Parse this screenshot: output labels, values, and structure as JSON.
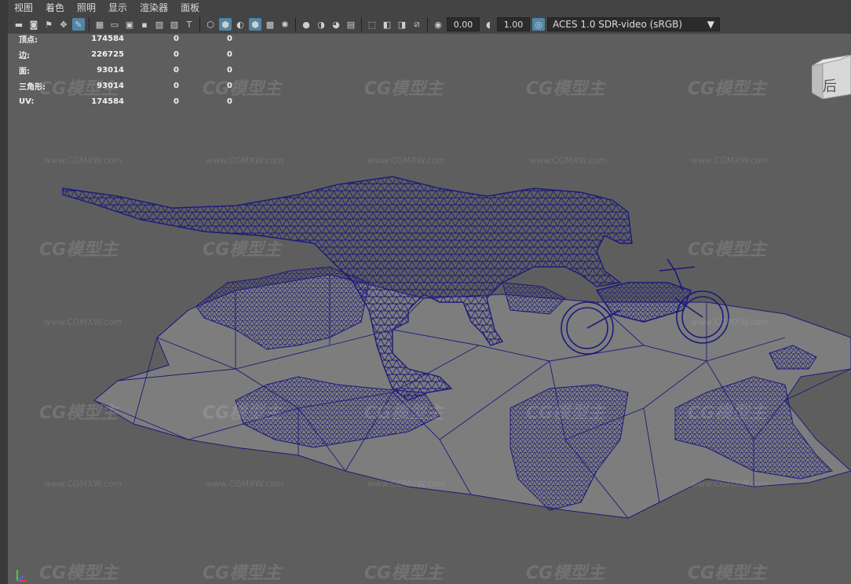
{
  "menu": [
    "视图",
    "着色",
    "照明",
    "显示",
    "渲染器",
    "面板"
  ],
  "toolbar": {
    "near_clip": "0.00",
    "gamma": "1.00",
    "colorspace": "ACES 1.0 SDR-video (sRGB)"
  },
  "hud": {
    "rows": [
      {
        "label": "顶点:",
        "a": "174584",
        "b": "0",
        "c": "0"
      },
      {
        "label": "边:",
        "a": "226725",
        "b": "0",
        "c": "0"
      },
      {
        "label": "面:",
        "a": "93014",
        "b": "0",
        "c": "0"
      },
      {
        "label": "三角形:",
        "a": "93014",
        "b": "0",
        "c": "0"
      },
      {
        "label": "UV:",
        "a": "174584",
        "b": "0",
        "c": "0"
      }
    ]
  },
  "viewcube": {
    "face_label": "后"
  },
  "watermark": {
    "logo": "CG模型主",
    "url": "www.CGMXW.com"
  },
  "colors": {
    "wire": "#1c1a7a",
    "viewport_bg": "#5e5e5e",
    "ground": "#7d7d7d"
  }
}
